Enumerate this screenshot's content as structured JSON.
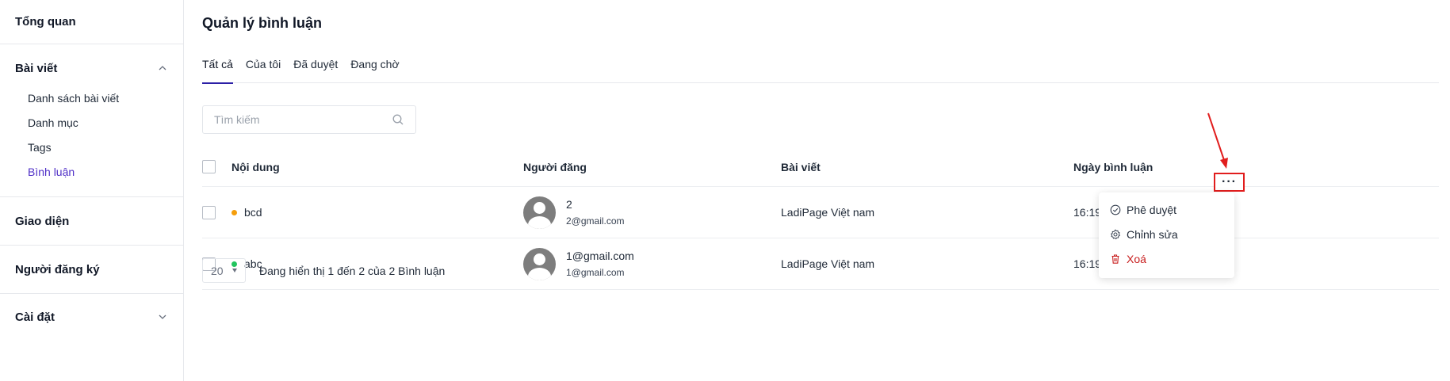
{
  "sidebar": {
    "overview": "Tổng quan",
    "posts": {
      "label": "Bài viết",
      "items": [
        "Danh sách bài viết",
        "Danh mục",
        "Tags",
        "Bình luận"
      ],
      "active_index": 3
    },
    "appearance": "Giao diện",
    "subscribers": "Người đăng ký",
    "settings": "Cài đặt"
  },
  "page": {
    "title": "Quản lý bình luận",
    "tabs": [
      "Tất cả",
      "Của tôi",
      "Đã duyệt",
      "Đang chờ"
    ],
    "active_tab": 0
  },
  "search": {
    "placeholder": "Tìm kiếm"
  },
  "table": {
    "headers": {
      "content": "Nội dung",
      "author": "Người đăng",
      "post": "Bài viết",
      "date": "Ngày bình luận"
    },
    "rows": [
      {
        "status_color": "#f59e0b",
        "content": "bcd",
        "author_name": "2",
        "author_email": "2@gmail.com",
        "post": "LadiPage Việt nam",
        "date": "16:19 24/07/2023"
      },
      {
        "status_color": "#22c55e",
        "content": "abc",
        "author_name": "1@gmail.com",
        "author_email": "1@gmail.com",
        "post": "LadiPage Việt nam",
        "date": "16:19 24/07/"
      }
    ]
  },
  "row_menu": {
    "more_label": "···",
    "items": {
      "approve": "Phê duyệt",
      "edit": "Chỉnh sửa",
      "delete": "Xoá"
    }
  },
  "pagination": {
    "page_size": "20",
    "summary": "Đang hiển thị 1 đến 2 của 2 Bình luận"
  },
  "colors": {
    "accent": "#4f2fc7",
    "tab_underline": "#2c1fa6",
    "annotation": "#e11d1d",
    "danger": "#c81e1e"
  }
}
